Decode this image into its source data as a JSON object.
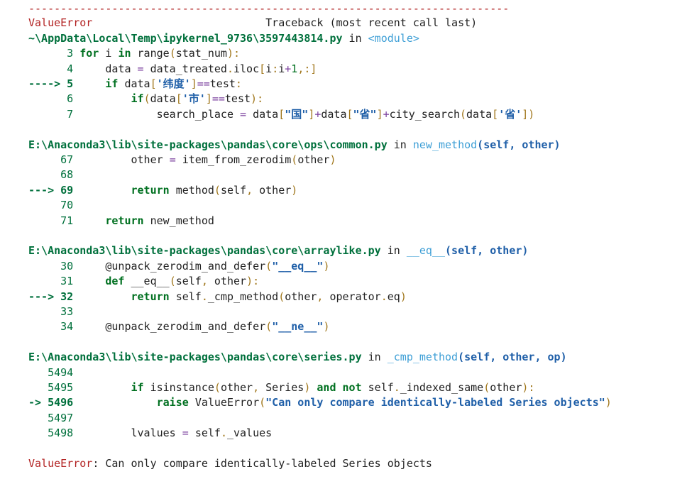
{
  "separator": "---------------------------------------------------------------------------",
  "exception_name": "ValueError",
  "traceback_header": "Traceback (most recent call last)",
  "frames": [
    {
      "file": "~\\AppData\\Local\\Temp\\ipykernel_9736\\3597443814.py",
      "in_text": " in ",
      "func": "<module>",
      "args": "",
      "lines": [
        {
          "prefix": "      3 ",
          "code": "for i in range(stat_num):"
        },
        {
          "prefix": "      4 ",
          "code": "    data = data_treated.iloc[i:i+1,:]"
        },
        {
          "prefix": "----> 5 ",
          "code": "    if data['纬度']==test:",
          "current": true
        },
        {
          "prefix": "      6 ",
          "code": "        if(data['市']==test):"
        },
        {
          "prefix": "      7 ",
          "code": "            search_place = data[\"国\"]+data[\"省\"]+city_search(data['省'])"
        }
      ]
    },
    {
      "file": "E:\\Anaconda3\\lib\\site-packages\\pandas\\core\\ops\\common.py",
      "in_text": " in ",
      "func": "new_method",
      "args": "(self, other)",
      "lines": [
        {
          "prefix": "     67 ",
          "code": "        other = item_from_zerodim(other)"
        },
        {
          "prefix": "     68 ",
          "code": ""
        },
        {
          "prefix": "---> 69 ",
          "code": "        return method(self, other)",
          "current": true
        },
        {
          "prefix": "     70 ",
          "code": ""
        },
        {
          "prefix": "     71 ",
          "code": "    return new_method"
        }
      ]
    },
    {
      "file": "E:\\Anaconda3\\lib\\site-packages\\pandas\\core\\arraylike.py",
      "in_text": " in ",
      "func": "__eq__",
      "args": "(self, other)",
      "lines": [
        {
          "prefix": "     30 ",
          "code": "    @unpack_zerodim_and_defer(\"__eq__\")"
        },
        {
          "prefix": "     31 ",
          "code": "    def __eq__(self, other):"
        },
        {
          "prefix": "---> 32 ",
          "code": "        return self._cmp_method(other, operator.eq)",
          "current": true
        },
        {
          "prefix": "     33 ",
          "code": ""
        },
        {
          "prefix": "     34 ",
          "code": "    @unpack_zerodim_and_defer(\"__ne__\")"
        }
      ]
    },
    {
      "file": "E:\\Anaconda3\\lib\\site-packages\\pandas\\core\\series.py",
      "in_text": " in ",
      "func": "_cmp_method",
      "args": "(self, other, op)",
      "lines": [
        {
          "prefix": "   5494 ",
          "code": ""
        },
        {
          "prefix": "   5495 ",
          "code": "        if isinstance(other, Series) and not self._indexed_same(other):"
        },
        {
          "prefix": "-> 5496 ",
          "code": "            raise ValueError(\"Can only compare identically-labeled Series objects\")",
          "current": true
        },
        {
          "prefix": "   5497 ",
          "code": ""
        },
        {
          "prefix": "   5498 ",
          "code": "        lvalues = self._values"
        }
      ]
    }
  ],
  "final_error": {
    "name": "ValueError",
    "message": ": Can only compare identically-labeled Series objects"
  }
}
